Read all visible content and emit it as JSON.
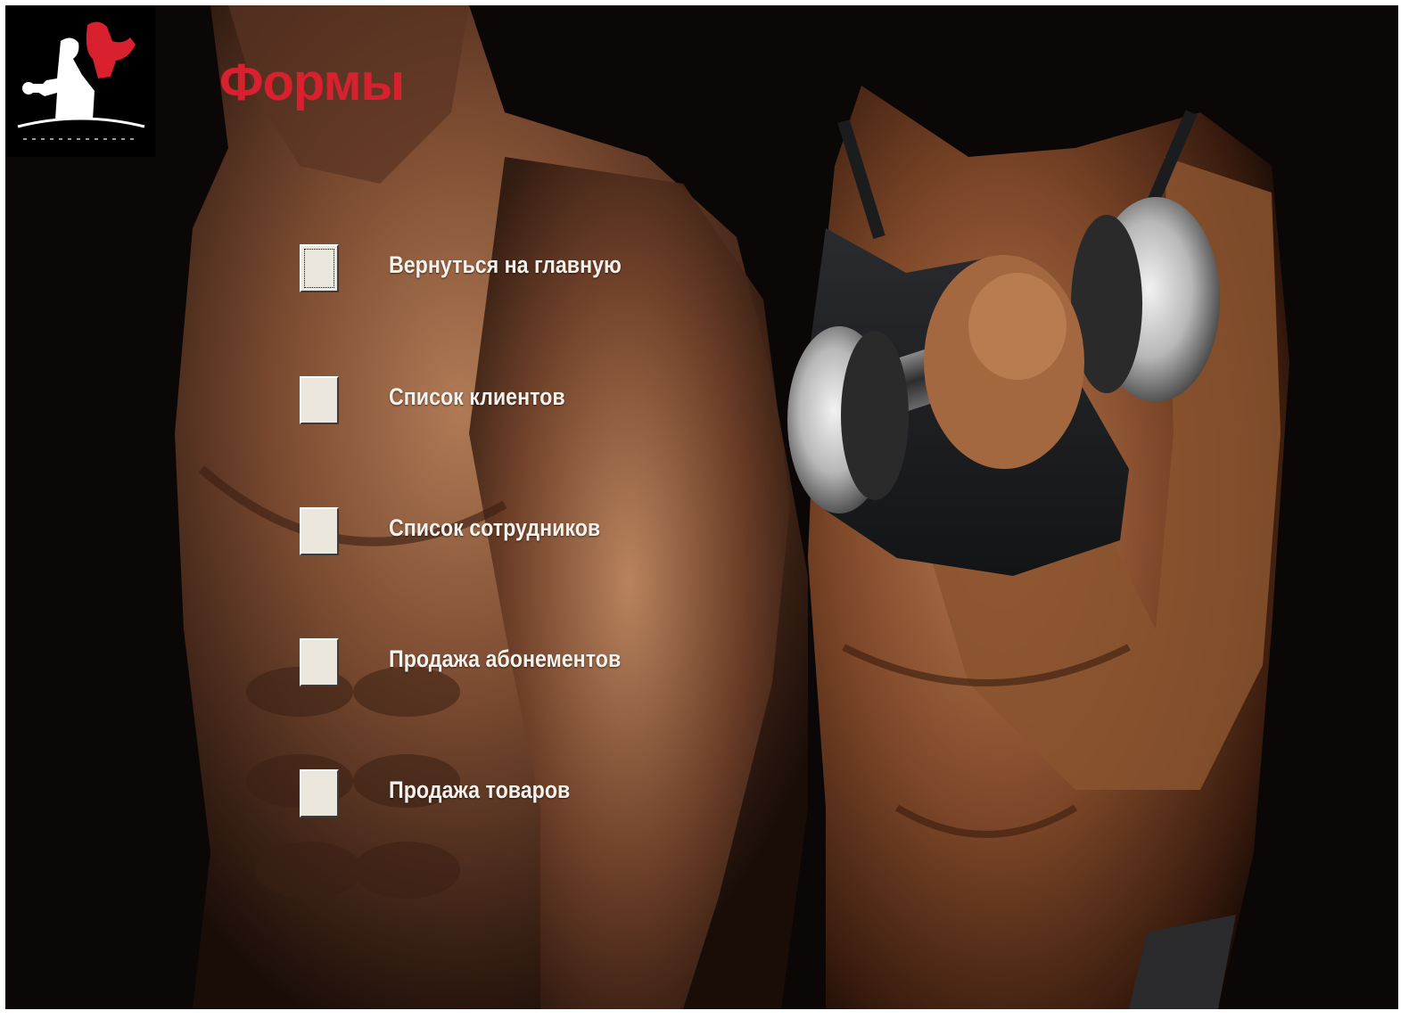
{
  "header": {
    "title": "Формы"
  },
  "logo": {
    "icon": "fitness-club-logo-icon",
    "accent_color": "#d9202f"
  },
  "menu": {
    "items": [
      {
        "label": "Вернуться на главную",
        "focused": true
      },
      {
        "label": "Список клиентов",
        "focused": false
      },
      {
        "label": "Список сотрудников",
        "focused": false
      },
      {
        "label": "Продажа абонементов",
        "focused": false
      },
      {
        "label": "Продажа товаров",
        "focused": false
      }
    ]
  },
  "colors": {
    "title": "#d9202f",
    "label": "#f4f1ec",
    "button_face": "#ebe7dc",
    "background": "#0a0706"
  }
}
